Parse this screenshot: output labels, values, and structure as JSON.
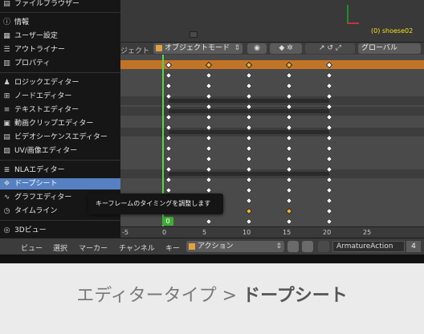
{
  "viewport": {
    "object_label": "(0) shoese02"
  },
  "header": {
    "object_menu": "ジェクト",
    "mode": "オブジェクトモード",
    "orientation": "グローバル"
  },
  "menu": {
    "items": [
      {
        "label": "ファイルブラウザー",
        "icon": "folder-icon"
      },
      {
        "label": "情報",
        "icon": "info-icon"
      },
      {
        "label": "ユーザー設定",
        "icon": "preferences-icon"
      },
      {
        "label": "アウトライナー",
        "icon": "outliner-icon"
      },
      {
        "label": "プロパティ",
        "icon": "properties-icon"
      },
      {
        "label": "ロジックエディター",
        "icon": "logic-icon"
      },
      {
        "label": "ノードエディター",
        "icon": "node-icon"
      },
      {
        "label": "テキストエディター",
        "icon": "text-icon"
      },
      {
        "label": "動画クリップエディター",
        "icon": "clip-icon"
      },
      {
        "label": "ビデオシーケンスエディター",
        "icon": "sequencer-icon"
      },
      {
        "label": "UV/画像エディター",
        "icon": "image-icon"
      },
      {
        "label": "NLAエディター",
        "icon": "nla-icon"
      },
      {
        "label": "ドープシート",
        "icon": "dopesheet-icon"
      },
      {
        "label": "グラフエディター",
        "icon": "graph-icon"
      },
      {
        "label": "タイムライン",
        "icon": "timeline-icon"
      },
      {
        "label": "3Dビュー",
        "icon": "view3d-icon"
      }
    ]
  },
  "tooltip": "キーフレームのタイミングを調整します",
  "current_frame": "0",
  "ruler": [
    "-5",
    "0",
    "5",
    "10",
    "15",
    "20",
    "25"
  ],
  "bottom": {
    "menus": [
      "ビュー",
      "選択",
      "マーカー",
      "チャンネル",
      "キー"
    ],
    "action_label": "アクション",
    "action_name": "ArmatureAction",
    "users": "4"
  },
  "caption": {
    "prefix": "エディタータイプ > ",
    "bold": "ドープシート"
  }
}
